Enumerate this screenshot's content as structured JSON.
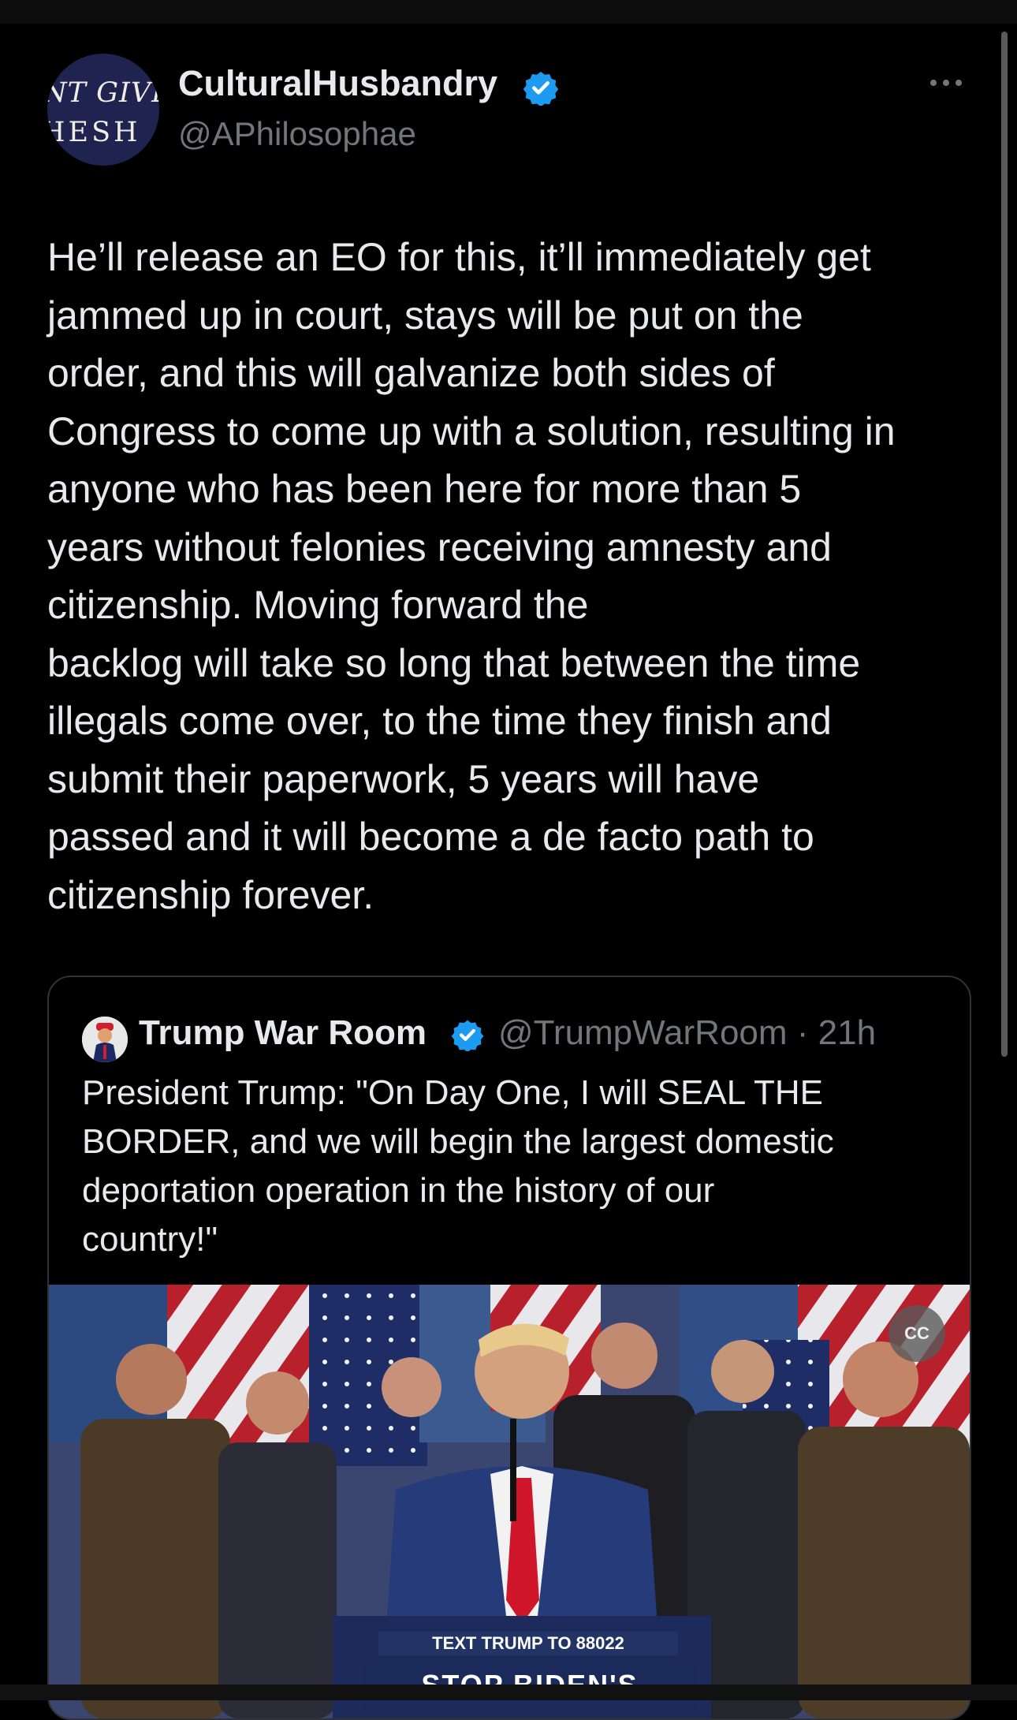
{
  "post": {
    "avatar_text_line1": "NT GIVE",
    "avatar_text_line2": "HESH",
    "display_name": "CulturalHusbandry",
    "handle": "@APhilosophae",
    "body_lines": [
      "He’ll release an EO for this, it’ll immediately get",
      "jammed up in court, stays will be put on the",
      "order, and this will galvanize both sides of",
      "Congress to come up with a solution, resulting in",
      "anyone who has been here for more than 5",
      "years without felonies receiving amnesty and",
      "citizenship. Moving forward the",
      "backlog will take so long that between the time",
      "illegals come over, to the time they finish and",
      "submit their paperwork, 5 years will have",
      "passed and it will become a de facto path to",
      "citizenship forever."
    ]
  },
  "quoted_post": {
    "display_name": "Trump War Room",
    "handle_time": "@TrumpWarRoom · 21h",
    "text_lines": [
      "President Trump: \"On Day One, I will SEAL THE",
      "BORDER, and we will begin the largest domestic",
      "deportation operation in the history of our",
      "country!\""
    ],
    "video": {
      "cc_label": "CC",
      "sign_line1": "TEXT TRUMP TO 88022",
      "sign_line2": "STOP BIDEN'S"
    }
  },
  "colors": {
    "background": "#000000",
    "text_primary": "#e7e9ea",
    "text_secondary": "#71767b",
    "verified_blue": "#1d9bf0",
    "border": "#2f3336"
  },
  "icons": [
    "verified-badge-icon",
    "more-options-icon",
    "captions-icon"
  ]
}
